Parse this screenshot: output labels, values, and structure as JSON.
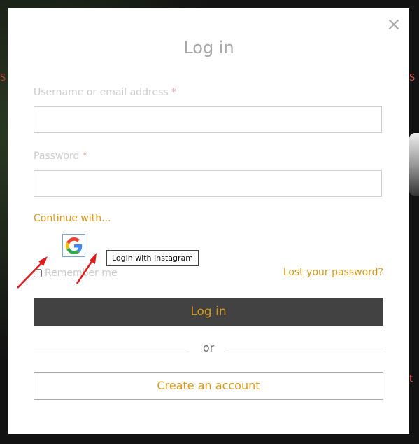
{
  "modal": {
    "title": "Log in",
    "close_glyph": "×",
    "username_label": "Username or email address",
    "username_required": "*",
    "username_value": "",
    "password_label": "Password",
    "password_required": "*",
    "password_value": "",
    "continue_with": "Continue with...",
    "social": {
      "google_icon": "google-icon",
      "tooltip": "Login with Instagram"
    },
    "remember_label": "Remember me",
    "remember_checked": false,
    "lost_password": "Lost your password?",
    "login_button": "Log in",
    "or_text": "or",
    "create_account": "Create an account"
  },
  "colors": {
    "accent": "#d49a1e",
    "button_dark": "#424242",
    "annotation_arrow": "#e0191a"
  },
  "annotations": {
    "arrow_count": 2
  }
}
